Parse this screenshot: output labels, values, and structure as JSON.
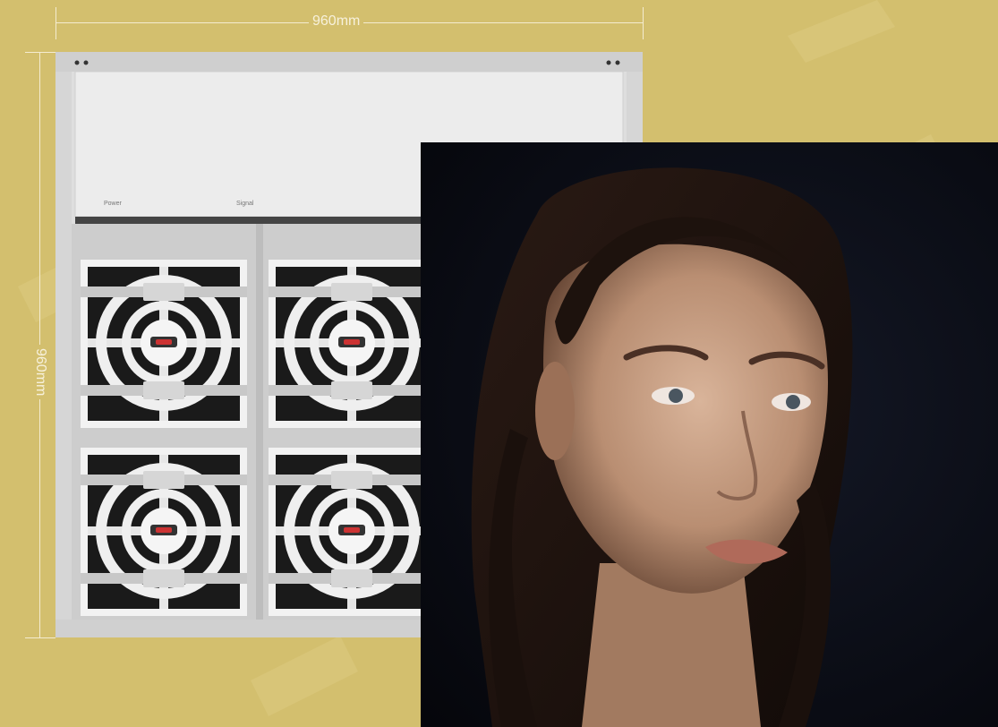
{
  "dimensions": {
    "width_label": "960mm",
    "height_label": "960mm"
  },
  "cabinet": {
    "power_label": "Power",
    "signal_label": "Signal"
  },
  "colors": {
    "background": "#d3bf6e",
    "dimension_line": "#f4ecd0",
    "cabinet_frame": "#dcdcdc",
    "module_black": "#1a1a1a",
    "portrait_background": "#0b0d17"
  }
}
